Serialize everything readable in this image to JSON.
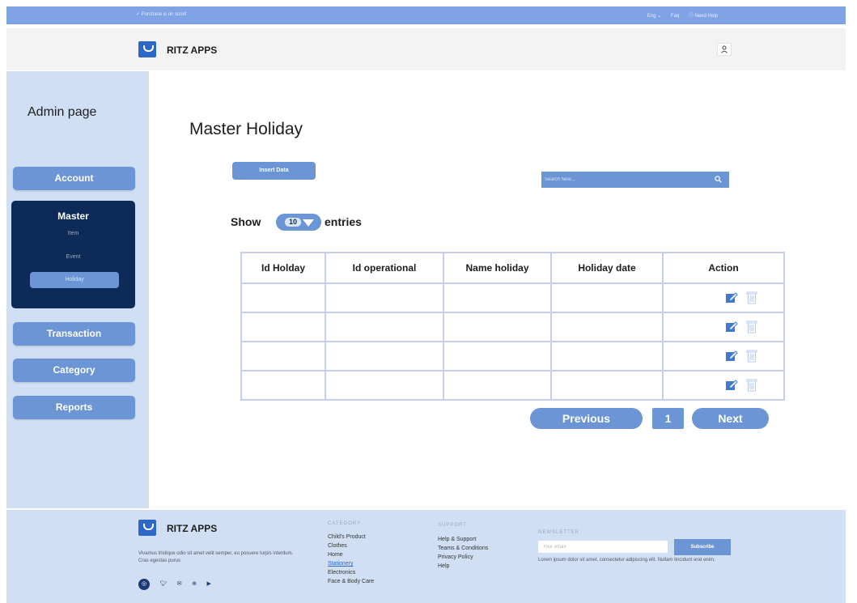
{
  "topbar": {
    "notice": "✓ Purchase is on scroll",
    "links": [
      "Eng ⌄",
      "Faq",
      "ⓘ Need Help"
    ]
  },
  "header": {
    "brand": "RITZ APPS",
    "user_icon": "person-icon"
  },
  "sidebar": {
    "title": "Admin page",
    "account": "Account",
    "master": {
      "title": "Master",
      "items": [
        "Item",
        "Event",
        "Holiday"
      ],
      "active": "Holiday"
    },
    "transaction": "Transaction",
    "category": "Category",
    "reports": "Reports"
  },
  "main": {
    "title": "Master Holiday",
    "insert_button": "Insert Data",
    "search_placeholder": "Search here...",
    "show_label": "Show",
    "entries_value": "10",
    "entries_label": "entries",
    "table": {
      "headers": [
        "Id Holday",
        "Id operational",
        "Name holiday",
        "Holiday date",
        "Action"
      ],
      "rows": [
        [
          "",
          "",
          "",
          ""
        ],
        [
          "",
          "",
          "",
          ""
        ],
        [
          "",
          "",
          "",
          ""
        ],
        [
          "",
          "",
          "",
          ""
        ]
      ],
      "action_icons": [
        "edit-icon",
        "trash-icon"
      ]
    },
    "pagination": {
      "previous": "Previous",
      "page": "1",
      "next": "Next"
    }
  },
  "footer": {
    "brand": "RITZ APPS",
    "description": "Vivamus tristique odio sit amet velit semper, eu posuere turpis interdum. Cras egestas purus",
    "socials": [
      "instagram-icon",
      "twitter-icon",
      "mail-icon",
      "pinterest-icon",
      "youtube-icon"
    ],
    "category": {
      "heading": "CATEGORY",
      "items": [
        "Child's Product",
        "Clothes",
        "Home",
        "Stationery",
        "Electronics",
        "Face & Body Care"
      ]
    },
    "support": {
      "heading": "SUPPORT",
      "items": [
        "Help & Support",
        "Teams & Conditions",
        "Privacy Policy",
        "Help"
      ]
    },
    "newsletter": {
      "heading": "NEWSLETTER",
      "placeholder": "Your email",
      "button": "Subscribe",
      "description": "Lorem ipsum dolor sit amet, consectetur adipiscing elit. Nullam tincidunt erat enim."
    }
  },
  "colors": {
    "accent": "#6b95d4",
    "topbar": "#7fa3e4",
    "sidebar": "#d0dff3",
    "master_box": "#0d2a58"
  }
}
